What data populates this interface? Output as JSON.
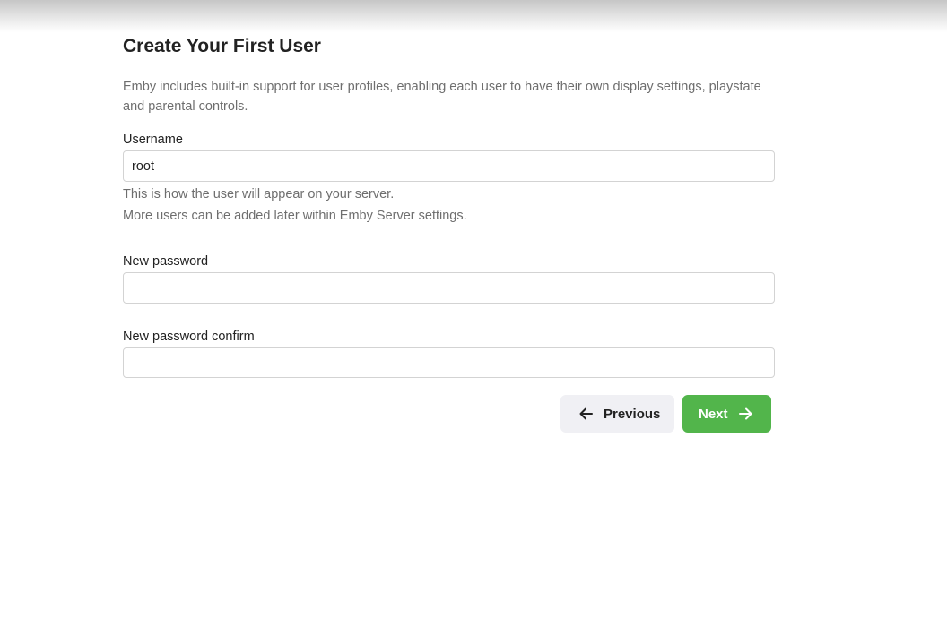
{
  "page": {
    "title": "Create Your First User",
    "intro": "Emby includes built-in support for user profiles, enabling each user to have their own display settings, playstate and parental controls."
  },
  "form": {
    "username": {
      "label": "Username",
      "value": "root",
      "help_line1": "This is how the user will appear on your server.",
      "help_line2": "More users can be added later within Emby Server settings."
    },
    "new_password": {
      "label": "New password",
      "value": ""
    },
    "new_password_confirm": {
      "label": "New password confirm",
      "value": ""
    }
  },
  "actions": {
    "previous_label": "Previous",
    "previous_icon": "arrow-left-icon",
    "next_label": "Next",
    "next_icon": "arrow-right-icon"
  },
  "colors": {
    "accent_green": "#52b54b",
    "secondary_button": "#f0f0f4",
    "muted_text": "#6e6e6e"
  }
}
